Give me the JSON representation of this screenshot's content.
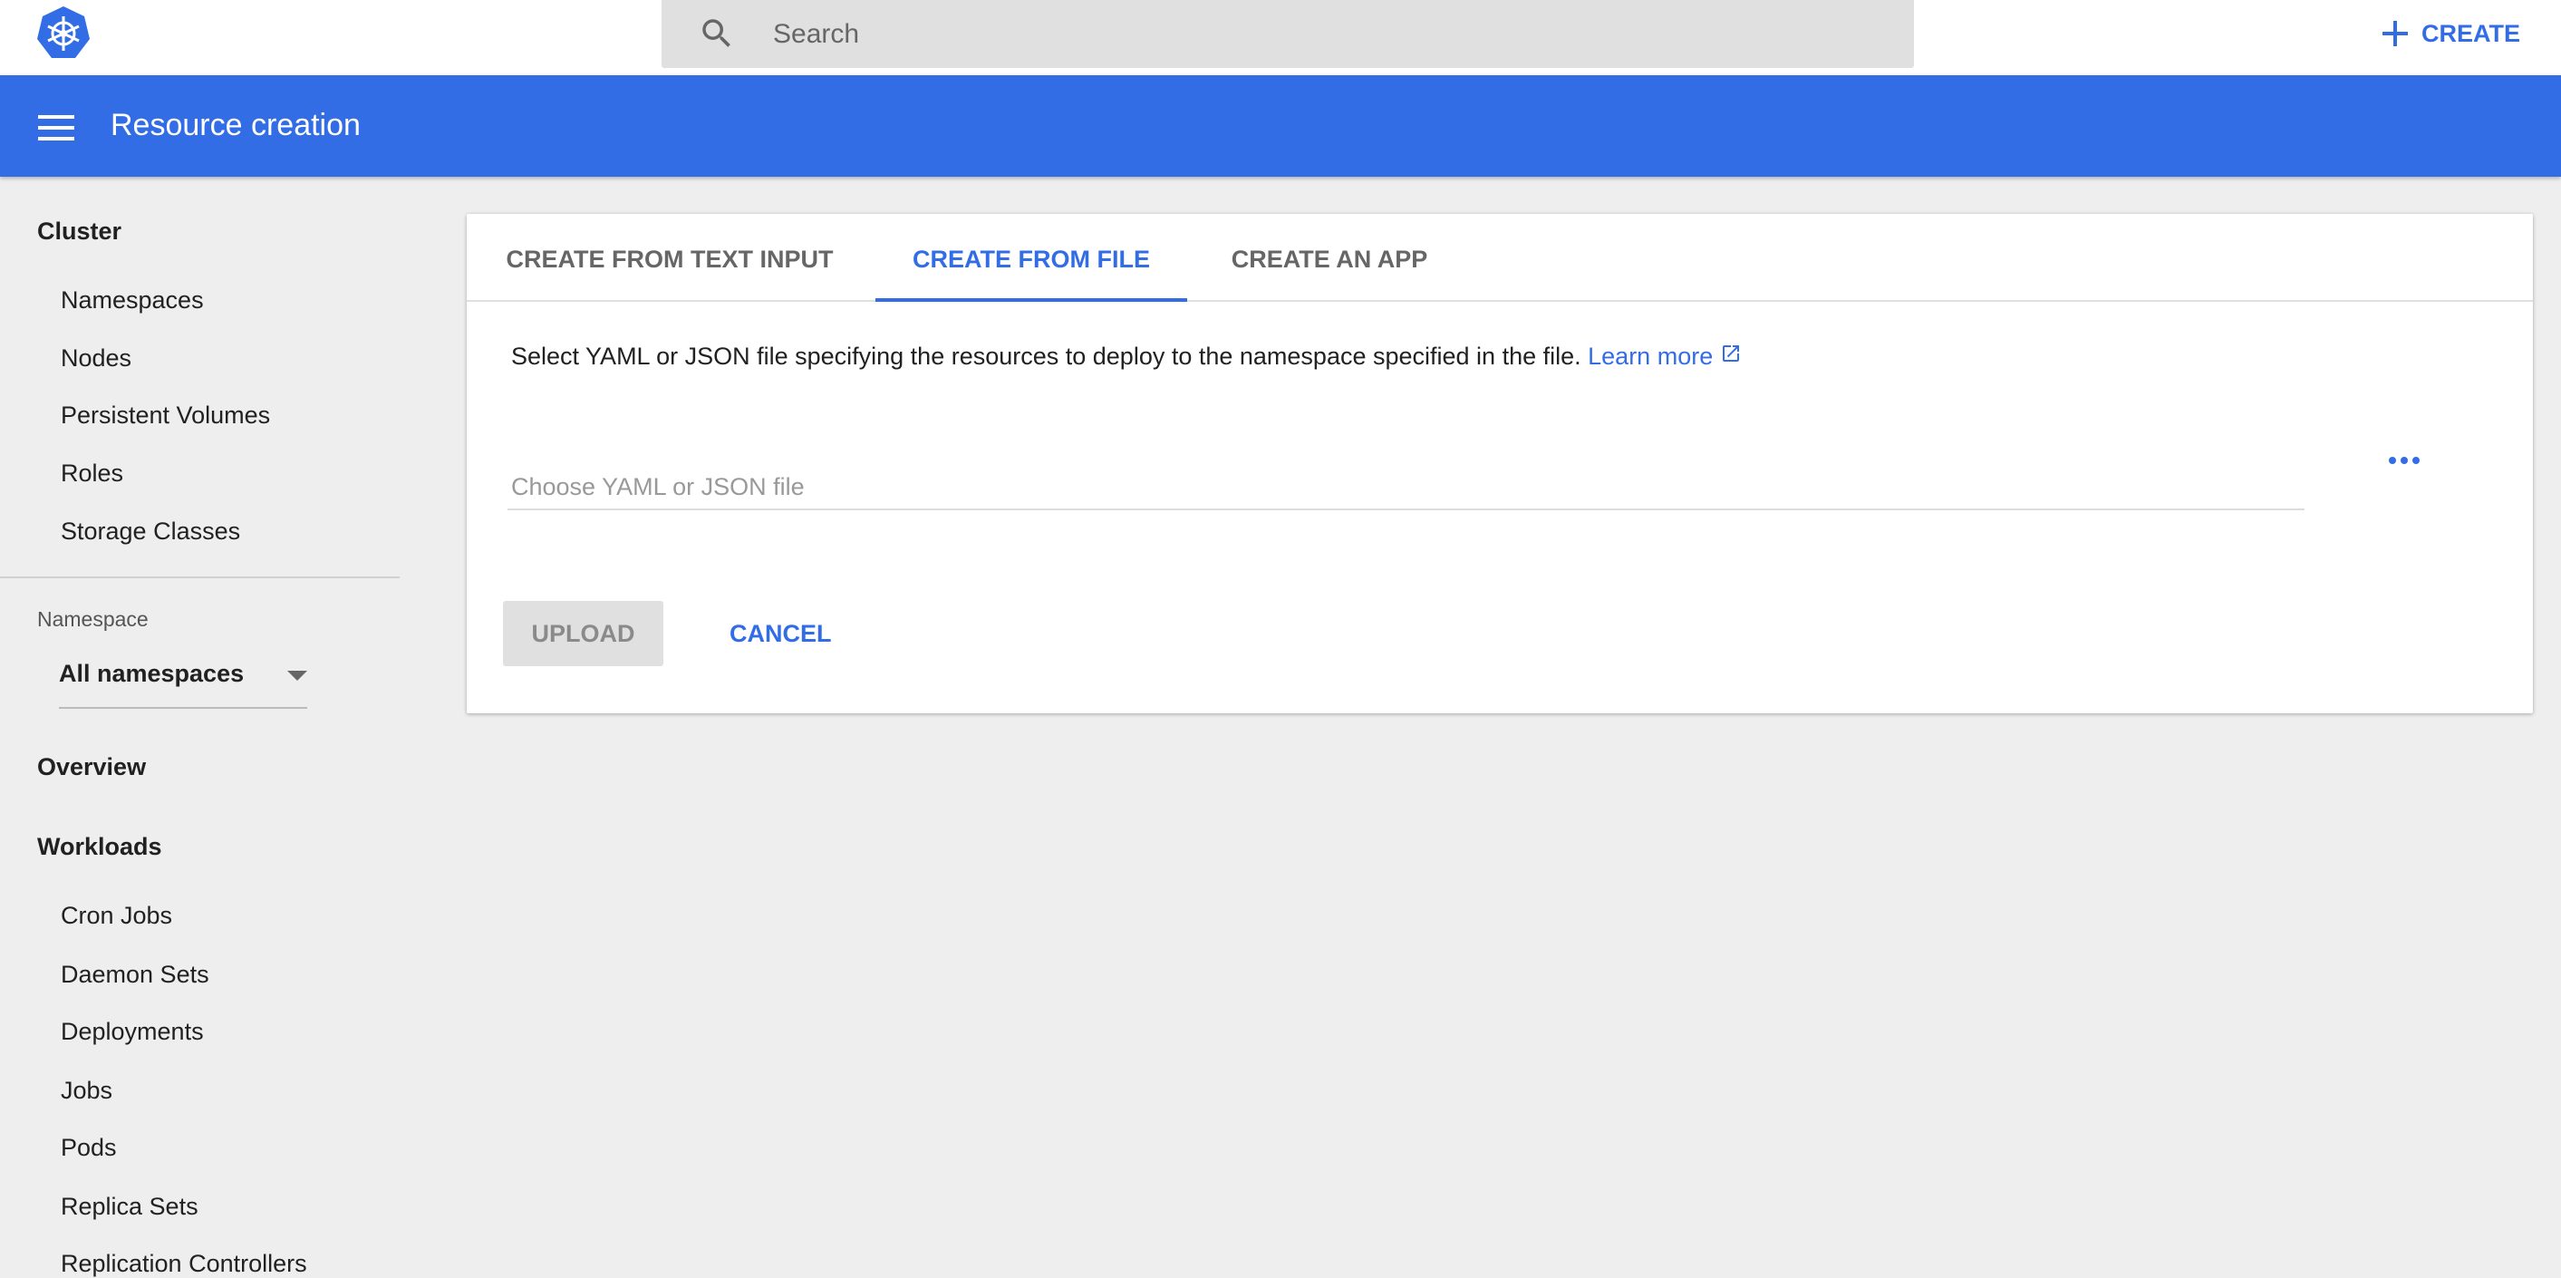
{
  "topbar": {
    "search_placeholder": "Search",
    "create_label": "CREATE",
    "logo": "kubernetes-logo"
  },
  "header": {
    "title": "Resource creation"
  },
  "sidebar": {
    "cluster_heading": "Cluster",
    "cluster_items": [
      "Namespaces",
      "Nodes",
      "Persistent Volumes",
      "Roles",
      "Storage Classes"
    ],
    "namespace_label": "Namespace",
    "namespace_value": "All namespaces",
    "overview": "Overview",
    "workloads_heading": "Workloads",
    "workload_items": [
      "Cron Jobs",
      "Daemon Sets",
      "Deployments",
      "Jobs",
      "Pods",
      "Replica Sets",
      "Replication Controllers"
    ]
  },
  "card": {
    "tabs": [
      "CREATE FROM TEXT INPUT",
      "CREATE FROM FILE",
      "CREATE AN APP"
    ],
    "active_tab": 1,
    "description": "Select YAML or JSON file specifying the resources to deploy to the namespace specified in the file.",
    "learn_more": "Learn more",
    "file_placeholder": "Choose YAML or JSON file",
    "upload_label": "UPLOAD",
    "cancel_label": "CANCEL"
  },
  "colors": {
    "accent": "#326de6",
    "background": "#eeeeee"
  }
}
